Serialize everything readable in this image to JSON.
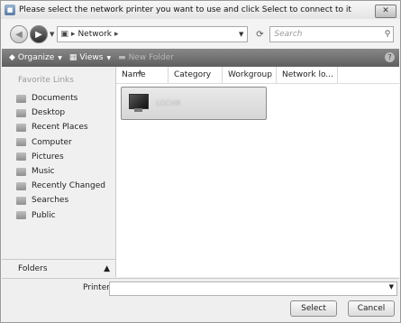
{
  "window": {
    "title": "Please select the network printer you want to use and click Select to connect to it",
    "close_glyph": "✕"
  },
  "address": {
    "crumb": "Network",
    "search_placeholder": "Search"
  },
  "toolbar": {
    "organize": "Organize",
    "views": "Views",
    "new_folder": "New Folder",
    "help": "?"
  },
  "nav": {
    "header": "Favorite Links",
    "items": [
      {
        "label": "Documents",
        "icon": "documents-icon"
      },
      {
        "label": "Desktop",
        "icon": "desktop-icon"
      },
      {
        "label": "Recent Places",
        "icon": "recent-places-icon"
      },
      {
        "label": "Computer",
        "icon": "computer-icon"
      },
      {
        "label": "Pictures",
        "icon": "pictures-icon"
      },
      {
        "label": "Music",
        "icon": "music-icon"
      },
      {
        "label": "Recently Changed",
        "icon": "recently-changed-icon"
      },
      {
        "label": "Searches",
        "icon": "searches-icon"
      },
      {
        "label": "Public",
        "icon": "public-icon"
      }
    ],
    "folders_label": "Folders"
  },
  "columns": [
    "Name",
    "Category",
    "Workgroup",
    "Network lo..."
  ],
  "items": [
    {
      "name": "LOCHR"
    }
  ],
  "bottom": {
    "printer_label": "Printer",
    "printer_value": "",
    "select": "Select",
    "cancel": "Cancel"
  }
}
